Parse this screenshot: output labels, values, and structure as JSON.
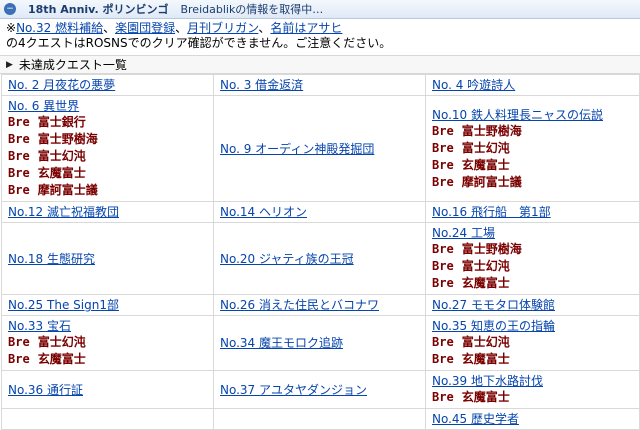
{
  "header": {
    "title": "18th Anniv. ポリンビンゴ",
    "status": "Breidablikの情報を取得中…"
  },
  "notice": {
    "prefix": "※",
    "links": [
      "No.32 燃料補給",
      "楽園団登録",
      "月刊ブリガン",
      "名前はアサヒ"
    ],
    "sep": "、",
    "line1_suffix": "",
    "line2": "の4クエストはROSNSでのクリア確認ができません。ご注意ください。"
  },
  "section": {
    "label": "未達成クエスト一覧"
  },
  "bre_prefix": "Bre",
  "rows": [
    [
      {
        "q": "No. 2 月夜花の悪夢",
        "bre": []
      },
      {
        "q": "No. 3 借金返済",
        "bre": []
      },
      {
        "q": "No. 4 吟遊詩人",
        "bre": []
      }
    ],
    [
      {
        "q": "No. 6 異世界",
        "bre": [
          "富士銀行",
          "富士野樹海",
          "富士幻沌",
          "玄魔富士",
          "摩訶富士議"
        ]
      },
      {
        "q": "No. 9 オーディン神殿発掘団",
        "bre": []
      },
      {
        "q": "No.10 鉄人料理長ニャスの伝説",
        "bre": [
          "富士野樹海",
          "富士幻沌",
          "玄魔富士",
          "摩訶富士議"
        ]
      }
    ],
    [
      {
        "q": "No.12 滅亡祝福教団",
        "bre": []
      },
      {
        "q": "No.14 ヘリオン",
        "bre": []
      },
      {
        "q": "No.16 飛行船　第1部",
        "bre": []
      }
    ],
    [
      {
        "q": "No.18 生態研究",
        "bre": []
      },
      {
        "q": "No.20 ジャティ族の王冠",
        "bre": []
      },
      {
        "q": "No.24 工場",
        "bre": [
          "富士野樹海",
          "富士幻沌",
          "玄魔富士"
        ]
      }
    ],
    [
      {
        "q": "No.25 The Sign1部",
        "bre": []
      },
      {
        "q": "No.26 消えた住民とバコナワ",
        "bre": []
      },
      {
        "q": "No.27 モモタロ体験館",
        "bre": []
      }
    ],
    [
      {
        "q": "No.33 宝石",
        "bre": [
          "富士幻沌",
          "玄魔富士"
        ]
      },
      {
        "q": "No.34 魔王モロク追跡",
        "bre": []
      },
      {
        "q": "No.35 知恵の王の指輪",
        "bre": [
          "富士幻沌",
          "玄魔富士"
        ]
      }
    ],
    [
      {
        "q": "No.36 通行証",
        "bre": []
      },
      {
        "q": "No.37 アユタヤダンジョン",
        "bre": []
      },
      {
        "q": "No.39 地下水路討伐",
        "bre": [
          "玄魔富士"
        ]
      }
    ],
    [
      {
        "q": "",
        "bre": []
      },
      {
        "q": "",
        "bre": []
      },
      {
        "q": "No.45 歴史学者",
        "bre": []
      }
    ]
  ]
}
